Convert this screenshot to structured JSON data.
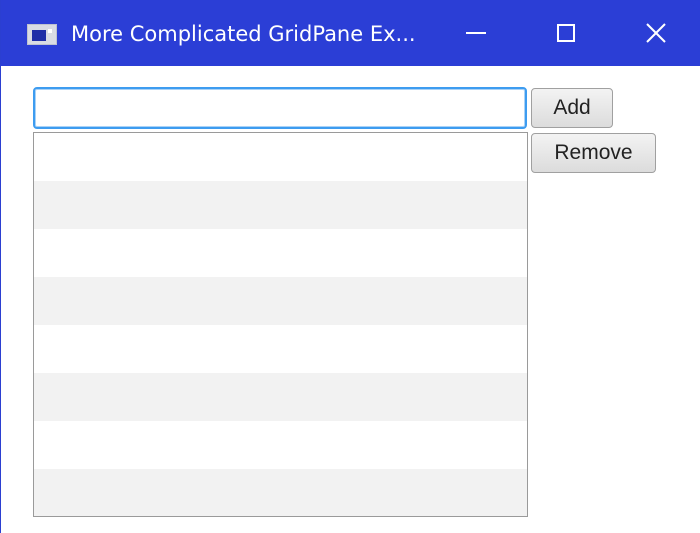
{
  "window": {
    "title": "More Complicated GridPane Ex...",
    "icons": {
      "app": "app-window-icon",
      "minimize": "minimize-icon",
      "maximize": "maximize-icon",
      "close": "close-icon"
    },
    "colors": {
      "titlebar": "#2b3ed6",
      "focus": "#3d9cf0",
      "row_alt": "#f2f2f2"
    }
  },
  "form": {
    "input": {
      "value": "",
      "placeholder": ""
    },
    "add_label": "Add",
    "remove_label": "Remove"
  },
  "list": {
    "items": [
      "",
      "",
      "",
      "",
      "",
      "",
      "",
      ""
    ]
  }
}
